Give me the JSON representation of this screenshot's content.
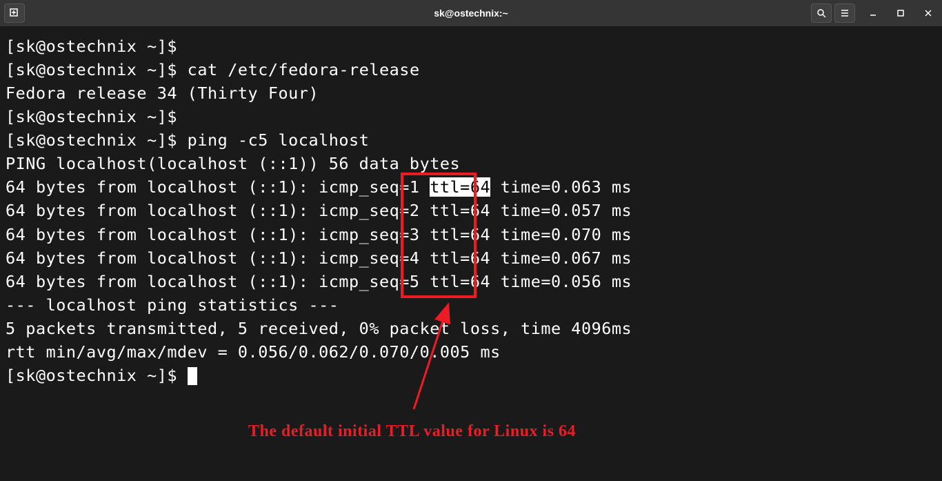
{
  "titlebar": {
    "title": "sk@ostechnix:~"
  },
  "terminal": {
    "prompt": "[sk@ostechnix ~]$",
    "lines": {
      "l0": "[sk@ostechnix ~]$",
      "l1_cmd": " cat /etc/fedora-release",
      "l2": "Fedora release 34 (Thirty Four)",
      "l3": "[sk@ostechnix ~]$",
      "l4_cmd": " ping -c5 localhost",
      "l5": "PING localhost(localhost (::1)) 56 data bytes",
      "ping1_a": "64 bytes from localhost (::1): icmp_seq=1 ",
      "ping1_ttl": "ttl=64",
      "ping1_b": " time=0.063 ms",
      "ping2": "64 bytes from localhost (::1): icmp_seq=2 ttl=64 time=0.057 ms",
      "ping3": "64 bytes from localhost (::1): icmp_seq=3 ttl=64 time=0.070 ms",
      "ping4": "64 bytes from localhost (::1): icmp_seq=4 ttl=64 time=0.067 ms",
      "ping5": "64 bytes from localhost (::1): icmp_seq=5 ttl=64 time=0.056 ms",
      "blank": "",
      "stats_hdr": "--- localhost ping statistics ---",
      "stats1": "5 packets transmitted, 5 received, 0% packet loss, time 4096ms",
      "stats2": "rtt min/avg/max/mdev = 0.056/0.062/0.070/0.005 ms",
      "final_prompt": "[sk@ostechnix ~]$ "
    }
  },
  "annotation": {
    "text": "The default initial TTL value for Linux is 64"
  }
}
